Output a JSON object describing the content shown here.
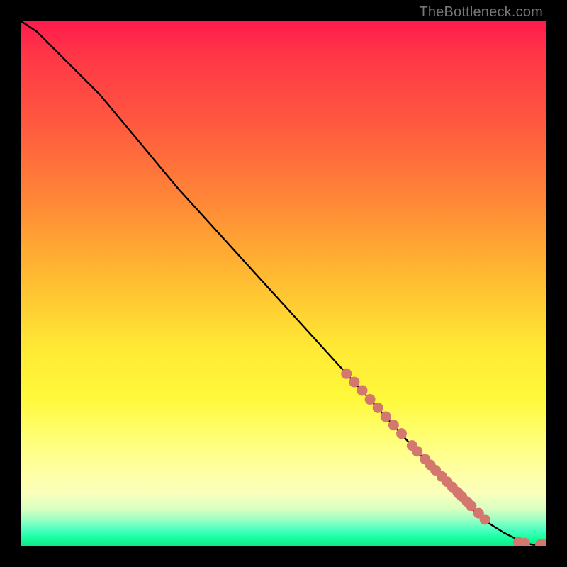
{
  "watermark": "TheBottleneck.com",
  "chart_data": {
    "type": "line",
    "title": "",
    "xlabel": "",
    "ylabel": "",
    "xlim": [
      0,
      100
    ],
    "ylim": [
      0,
      100
    ],
    "series": [
      {
        "name": "curve",
        "style": "line",
        "color": "#000000",
        "x": [
          0,
          3,
          6,
          10,
          15,
          20,
          30,
          40,
          50,
          60,
          70,
          80,
          88,
          92,
          94,
          96,
          97.5,
          99.5
        ],
        "y": [
          100,
          98,
          95,
          91,
          86,
          80,
          68,
          57,
          46,
          35,
          24,
          13,
          5,
          2.5,
          1.5,
          0.6,
          0.2,
          0.2
        ]
      },
      {
        "name": "markers",
        "style": "scatter",
        "color": "#d4776f",
        "x": [
          62,
          63.5,
          65,
          66.5,
          68,
          69.5,
          71,
          72.5,
          74.5,
          75.5,
          77,
          78,
          79,
          80.2,
          81.2,
          82.2,
          83.2,
          84,
          85,
          85.8,
          87.2,
          88.4,
          94.8,
          96,
          99,
          99.6
        ],
        "y": [
          32.8,
          31.2,
          29.6,
          27.9,
          26.3,
          24.6,
          23.0,
          21.4,
          19.1,
          18.0,
          16.5,
          15.4,
          14.4,
          13.2,
          12.2,
          11.2,
          10.2,
          9.4,
          8.4,
          7.6,
          6.2,
          5.0,
          0.7,
          0.5,
          0.25,
          0.25
        ]
      }
    ]
  }
}
